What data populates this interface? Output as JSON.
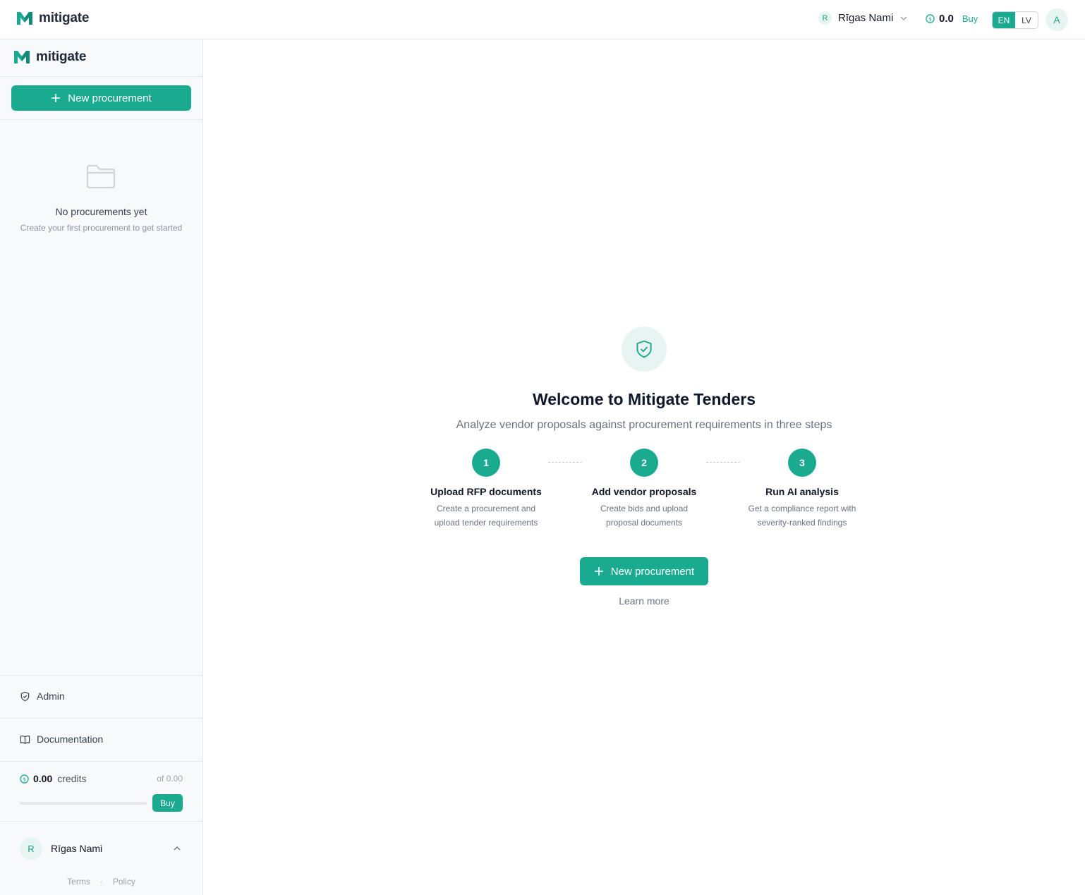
{
  "brand": {
    "name": "mitigate",
    "accent": "#1aaa90"
  },
  "topbar": {
    "org_initial": "R",
    "org_name": "Rīgas Nami",
    "credits_amount": "0.0",
    "buy_label": "Buy",
    "languages": [
      "EN",
      "LV"
    ],
    "active_language": "EN",
    "user_initial": "A"
  },
  "sidebar": {
    "new_procurement_label": "New procurement",
    "empty_title": "No procurements yet",
    "empty_subtitle": "Create your first procurement to get started",
    "nav": [
      {
        "label": "Admin",
        "icon": "shield-check-icon"
      },
      {
        "label": "Documentation",
        "icon": "book-open-icon"
      }
    ],
    "credits": {
      "value": "0.00",
      "label": "credits",
      "total": "of 0.00",
      "used_fraction": 0,
      "buy_label": "Buy"
    },
    "user": {
      "initial": "R",
      "name": "Rīgas Nami"
    },
    "footer": {
      "terms": "Terms",
      "separator": "·",
      "policy": "Policy"
    }
  },
  "main": {
    "title": "Welcome to Mitigate Tenders",
    "subtitle": "Analyze vendor proposals against procurement requirements in three steps",
    "steps": [
      {
        "number": "1",
        "title": "Upload RFP documents",
        "description": "Create a procurement and upload tender requirements"
      },
      {
        "number": "2",
        "title": "Add vendor proposals",
        "description": "Create bids and upload proposal documents"
      },
      {
        "number": "3",
        "title": "Run AI analysis",
        "description": "Get a compliance report with severity-ranked findings"
      }
    ],
    "cta_label": "New procurement",
    "learn_more": "Learn more"
  }
}
